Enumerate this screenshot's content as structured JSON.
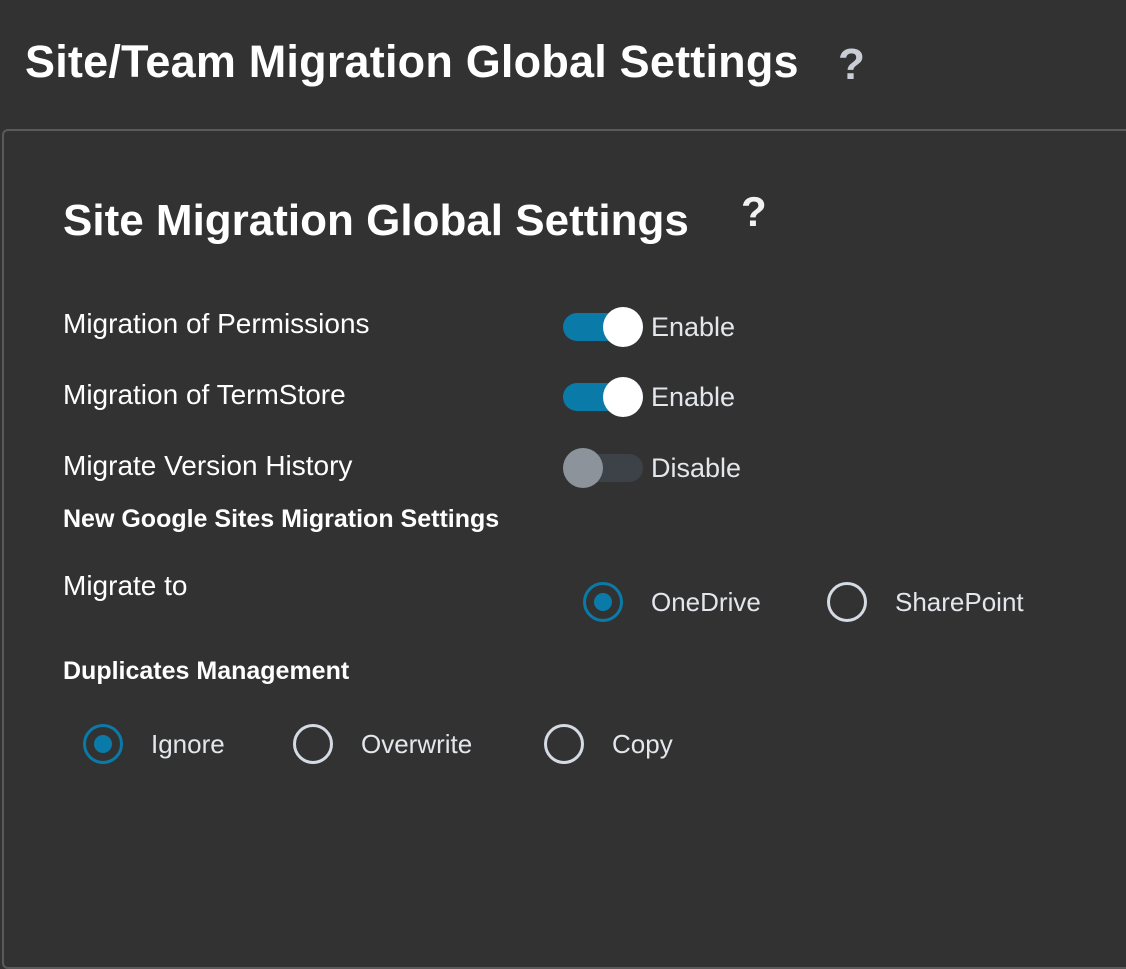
{
  "page": {
    "title": "Site/Team Migration Global Settings",
    "help_glyph": "?"
  },
  "site_settings": {
    "title": "Site Migration Global Settings",
    "help_glyph": "?",
    "rows": [
      {
        "label": "Migration of Permissions",
        "state": "Enable",
        "on": true
      },
      {
        "label": "Migration of TermStore",
        "state": "Enable",
        "on": true
      },
      {
        "label": "Migrate Version History",
        "state": "Disable",
        "on": false
      }
    ]
  },
  "google_sites": {
    "title": "New Google Sites Migration Settings",
    "migrate_to_label": "Migrate to",
    "options": [
      "OneDrive",
      "SharePoint"
    ],
    "selected": "OneDrive"
  },
  "duplicates": {
    "title": "Duplicates Management",
    "options": [
      "Ignore",
      "Overwrite",
      "Copy"
    ],
    "selected": "Ignore"
  },
  "colors": {
    "accent": "#0a7aa8",
    "background": "#323232",
    "toggle_off_track": "#3d4249",
    "toggle_off_knob": "#8c939b"
  },
  "icons": {
    "help": "question-mark-icon"
  }
}
